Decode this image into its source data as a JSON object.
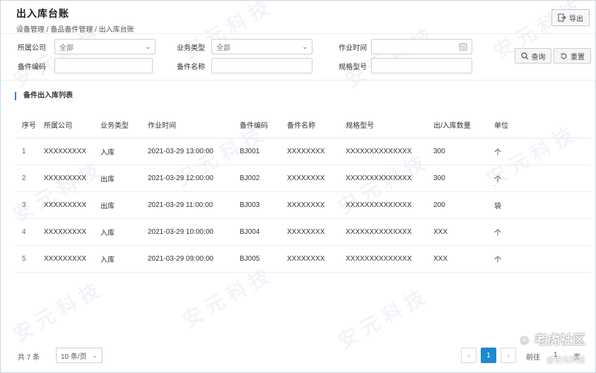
{
  "header": {
    "title": "出入库台账",
    "breadcrumb": "设备管理 / 备品备件管理 / 出入库台账",
    "export_label": "导出"
  },
  "filters": {
    "company_label": "所属公司",
    "company_value": "全部",
    "biztype_label": "业务类型",
    "biztype_value": "全部",
    "time_label": "作业时间",
    "code_label": "备件编码",
    "name_label": "备件名称",
    "spec_label": "规格型号",
    "query_label": "查询",
    "reset_label": "重置"
  },
  "section": {
    "title": "备件出入库列表"
  },
  "table": {
    "headers": [
      "序号",
      "所属公司",
      "业务类型",
      "作业时间",
      "备件编码",
      "备件名称",
      "规格型号",
      "出/入库数量",
      "单位"
    ],
    "rows": [
      [
        "1",
        "XXXXXXXXX",
        "入库",
        "2021-03-29 13:00:00",
        "BJ001",
        "XXXXXXXX",
        "XXXXXXXXXXXXXX",
        "300",
        "个"
      ],
      [
        "2",
        "XXXXXXXXX",
        "出库",
        "2021-03-29 12:00:00",
        "BJ002",
        "XXXXXXXX",
        "XXXXXXXXXXXXXX",
        "300",
        "个"
      ],
      [
        "3",
        "XXXXXXXXX",
        "出库",
        "2021-03-29 11:00:00",
        "BJ003",
        "XXXXXXXX",
        "XXXXXXXXXXXXXX",
        "200",
        "袋"
      ],
      [
        "4",
        "XXXXXXXXX",
        "入库",
        "2021-03-29 10:00:00",
        "BJ004",
        "XXXXXXXX",
        "XXXXXXXXXXXXXX",
        "XXX",
        "个"
      ],
      [
        "5",
        "XXXXXXXXX",
        "入库",
        "2021-03-29 09:00:00",
        "BJ005",
        "XXXXXXXX",
        "XXXXXXXXXXXXXX",
        "XXX",
        "个"
      ]
    ]
  },
  "pagination": {
    "total_text": "共 7 条",
    "page_size": "10 条/页",
    "current_page": "1",
    "goto_label": "前往",
    "goto_value": "1",
    "goto_suffix": "页"
  },
  "watermark": {
    "brand": "老虎社区",
    "sub": "@安元科技",
    "tile": "安 元 科 技"
  }
}
